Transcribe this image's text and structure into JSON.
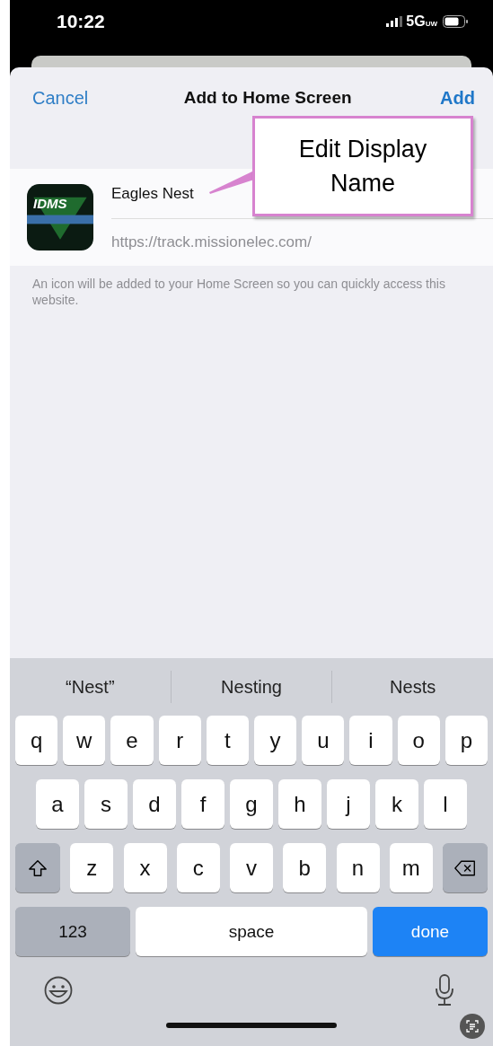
{
  "status_bar": {
    "time": "10:22",
    "network": "5G",
    "network_suffix": "UW"
  },
  "sheet": {
    "cancel": "Cancel",
    "title": "Add to Home Screen",
    "add": "Add"
  },
  "app": {
    "icon_label": "IDMS",
    "name": "Eagles Nest",
    "url": "https://track.missionelec.com/"
  },
  "note": "An icon will be added to your Home Screen so you can quickly access this website.",
  "callout": {
    "text": "Edit Display Name"
  },
  "keyboard": {
    "suggestions": [
      "“Nest”",
      "Nesting",
      "Nests"
    ],
    "rows": [
      {
        "keys": [
          {
            "kind": "letter",
            "label": "q"
          },
          {
            "kind": "letter",
            "label": "w"
          },
          {
            "kind": "letter",
            "label": "e"
          },
          {
            "kind": "letter",
            "label": "r"
          },
          {
            "kind": "letter",
            "label": "t"
          },
          {
            "kind": "letter",
            "label": "y"
          },
          {
            "kind": "letter",
            "label": "u"
          },
          {
            "kind": "letter",
            "label": "i"
          },
          {
            "kind": "letter",
            "label": "o"
          },
          {
            "kind": "letter",
            "label": "p"
          }
        ]
      },
      {
        "keys": [
          {
            "kind": "letter",
            "label": "a"
          },
          {
            "kind": "letter",
            "label": "s"
          },
          {
            "kind": "letter",
            "label": "d"
          },
          {
            "kind": "letter",
            "label": "f"
          },
          {
            "kind": "letter",
            "label": "g"
          },
          {
            "kind": "letter",
            "label": "h"
          },
          {
            "kind": "letter",
            "label": "j"
          },
          {
            "kind": "letter",
            "label": "k"
          },
          {
            "kind": "letter",
            "label": "l"
          }
        ]
      },
      {
        "keys": [
          {
            "kind": "shift"
          },
          {
            "kind": "letter",
            "label": "z"
          },
          {
            "kind": "letter",
            "label": "x"
          },
          {
            "kind": "letter",
            "label": "c"
          },
          {
            "kind": "letter",
            "label": "v"
          },
          {
            "kind": "letter",
            "label": "b"
          },
          {
            "kind": "letter",
            "label": "n"
          },
          {
            "kind": "letter",
            "label": "m"
          },
          {
            "kind": "delete"
          }
        ]
      },
      {
        "keys": [
          {
            "kind": "numbers",
            "label": "123"
          },
          {
            "kind": "space",
            "label": "space"
          },
          {
            "kind": "done",
            "label": "done"
          }
        ]
      }
    ]
  }
}
